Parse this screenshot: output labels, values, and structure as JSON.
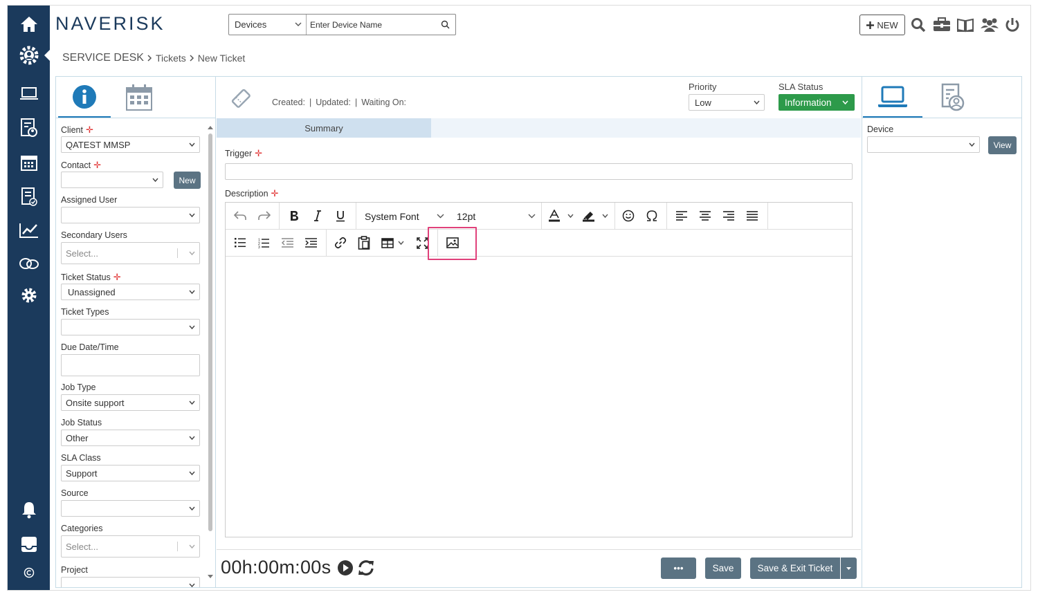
{
  "brand": {
    "logo": "NAVERISK"
  },
  "header": {
    "search_type": "Devices",
    "search_placeholder": "Enter Device Name",
    "new_label": "NEW"
  },
  "breadcrumb": {
    "root": "SERVICE DESK",
    "mid": "Tickets",
    "current": "New Ticket"
  },
  "nav_icons": [
    "home-icon",
    "service-desk-icon",
    "devices-icon",
    "reports-icon",
    "calendar-icon",
    "checklist-icon",
    "analytics-icon",
    "cloud-icon",
    "settings-icon",
    "notifications-icon",
    "inbox-icon",
    "copyright-icon"
  ],
  "left_fields": {
    "client_label": "Client",
    "client_value": "QATEST MMSP",
    "contact_label": "Contact",
    "contact_new": "New",
    "assigned_user_label": "Assigned User",
    "secondary_users_label": "Secondary Users",
    "secondary_users_placeholder": "Select...",
    "ticket_status_label": "Ticket Status",
    "ticket_status_value": "Unassigned",
    "ticket_types_label": "Ticket Types",
    "due_label": "Due Date/Time",
    "job_type_label": "Job Type",
    "job_type_value": "Onsite support",
    "job_status_label": "Job Status",
    "job_status_value": "Other",
    "sla_class_label": "SLA Class",
    "sla_class_value": "Support",
    "source_label": "Source",
    "categories_label": "Categories",
    "categories_placeholder": "Select...",
    "project_label": "Project"
  },
  "ticket_meta": {
    "created": "Created:",
    "updated": "Updated:",
    "waiting": "Waiting On:"
  },
  "priority": {
    "label": "Priority",
    "value": "Low"
  },
  "sla_status": {
    "label": "SLA Status",
    "value": "Information"
  },
  "summary_tab": "Summary",
  "trigger_label": "Trigger",
  "description_label": "Description",
  "editor": {
    "font": "System Font",
    "size": "12pt"
  },
  "timer": "00h:00m:00s",
  "actions": {
    "more": "•••",
    "save": "Save",
    "save_exit": "Save & Exit Ticket"
  },
  "right": {
    "device_label": "Device",
    "view": "View"
  },
  "colors": {
    "nav": "#1b3a5c",
    "accent": "#1f7ab8",
    "sla_green": "#2d9a4a",
    "button": "#5b7383",
    "highlight": "#e0407a"
  }
}
